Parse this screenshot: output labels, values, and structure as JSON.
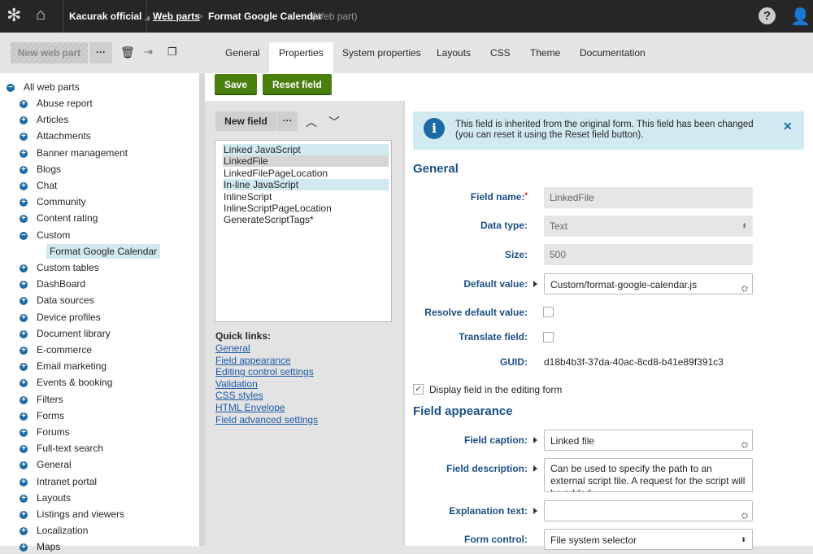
{
  "header": {
    "site": "Kacurak official",
    "breadcrumb_link": "Web parts",
    "breadcrumb_sep": ">",
    "current": "Format Google Calendar",
    "current_type": "(Web part)"
  },
  "toolbar": {
    "new_web_part": "New web part",
    "more": "···"
  },
  "tabs": [
    "General",
    "Properties",
    "System properties",
    "Layouts",
    "CSS",
    "Theme",
    "Documentation"
  ],
  "active_tab": "Properties",
  "actions": {
    "save": "Save",
    "reset": "Reset field"
  },
  "tree": {
    "root": "All web parts",
    "items": [
      "Abuse report",
      "Articles",
      "Attachments",
      "Banner management",
      "Blogs",
      "Chat",
      "Community",
      "Content rating",
      "Custom",
      "Custom tables",
      "DashBoard",
      "Data sources",
      "Device profiles",
      "Document library",
      "E-commerce",
      "Email marketing",
      "Events & booking",
      "Filters",
      "Forms",
      "Forums",
      "Full-text search",
      "General",
      "Intranet portal",
      "Layouts",
      "Listings and viewers",
      "Localization",
      "Maps"
    ],
    "expanded": "Custom",
    "child": "Format Google Calendar"
  },
  "fields": {
    "new_field": "New field",
    "more": "···",
    "items": [
      "Linked JavaScript",
      "LinkedFile",
      "LinkedFilePageLocation",
      "In-line JavaScript",
      "InlineScript",
      "InlineScriptPageLocation",
      "GenerateScriptTags*"
    ],
    "selected": "LinkedFile"
  },
  "quick_links": {
    "title": "Quick links:",
    "items": [
      "General",
      "Field appearance",
      "Editing control settings",
      "Validation",
      "CSS styles",
      "HTML Envelope",
      "Field advanced settings"
    ]
  },
  "info": {
    "text": "This field is inherited from the original form. This field has been changed (you can reset it using the Reset field button)."
  },
  "general": {
    "title": "General",
    "field_name_label": "Field name:",
    "required": "*",
    "field_name": "LinkedFile",
    "data_type_label": "Data type:",
    "data_type": "Text",
    "size_label": "Size:",
    "size": "500",
    "default_label": "Default value:",
    "default": "Custom/format-google-calendar.js",
    "resolve_label": "Resolve default value:",
    "translate_label": "Translate field:",
    "guid_label": "GUID:",
    "guid": "d18b4b3f-37da-40ac-8cd8-b41e89f391c3",
    "display_label": "Display field in the editing form"
  },
  "appearance": {
    "title": "Field appearance",
    "caption_label": "Field caption:",
    "caption": "Linked file",
    "desc_label": "Field description:",
    "desc": "Can be used to specify the path to an external script file. A request for the script will be added",
    "expl_label": "Explanation text:",
    "expl": "",
    "control_label": "Form control:",
    "control": "File system selector"
  }
}
